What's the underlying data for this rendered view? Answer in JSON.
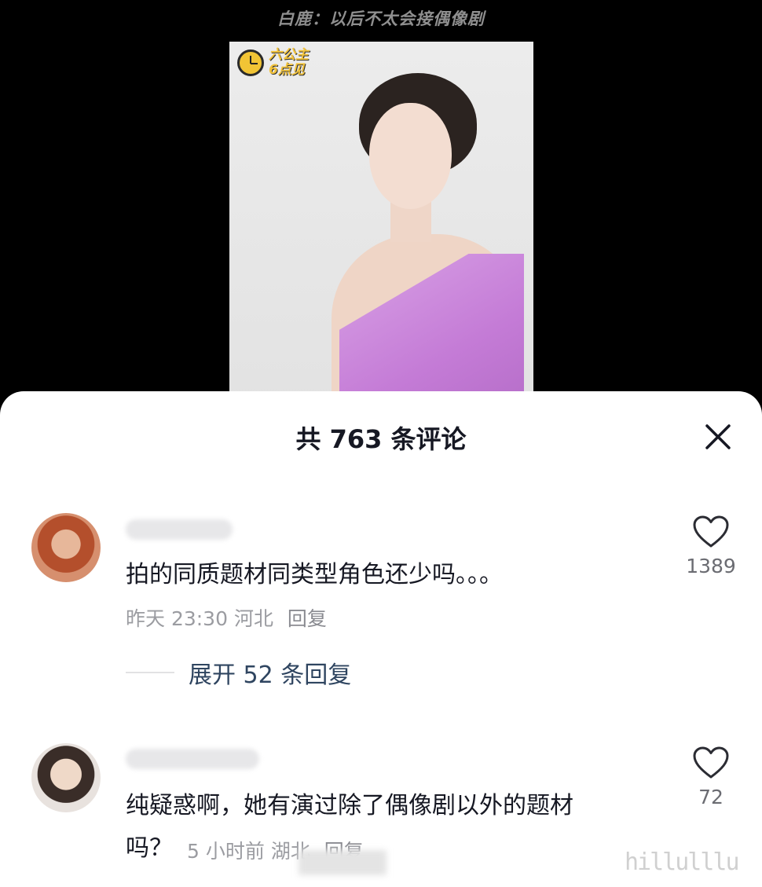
{
  "video": {
    "caption": "白鹿：以后不太会接偶像剧",
    "badge_line1": "六公主",
    "badge_line2": "6点见"
  },
  "comments_panel": {
    "title": "共 763 条评论",
    "close_icon": "close-icon"
  },
  "comments": [
    {
      "text": "拍的同质题材同类型角色还少吗。。。",
      "time": "昨天 23:30",
      "location": "河北",
      "reply_label": "回复",
      "likes": "1389",
      "expand_label": "展开 52 条回复"
    },
    {
      "text_line1": "纯疑惑啊，她有演过除了偶像剧以外的题材",
      "text_line2": "吗？",
      "time": "5 小时前",
      "location": "湖北",
      "reply_label": "回复",
      "likes": "72"
    }
  ],
  "colors": {
    "accent_link": "#2f4560",
    "meta_gray": "#9b9ca1",
    "text_dark": "#161823"
  },
  "watermark": "hillulllu"
}
